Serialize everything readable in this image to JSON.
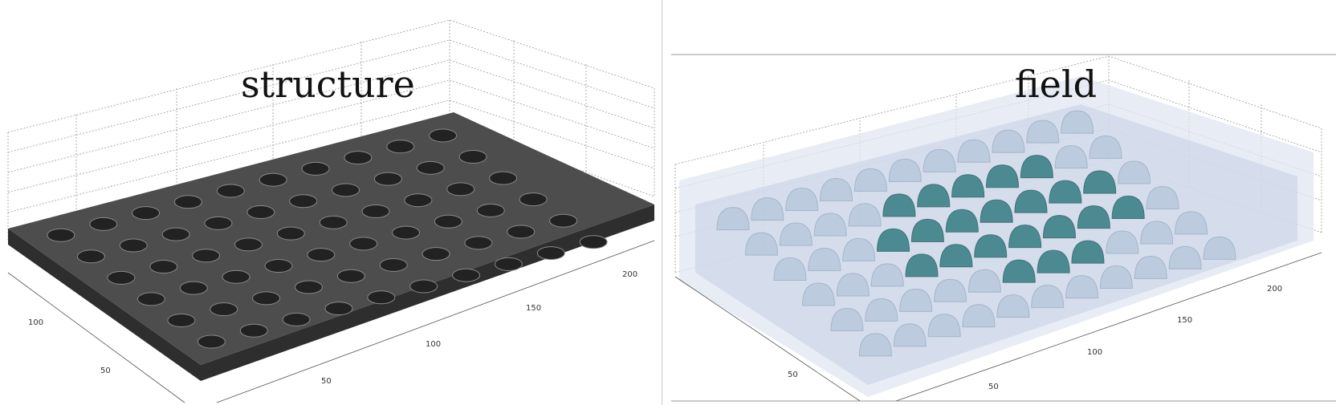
{
  "panels": [
    {
      "title": "structure",
      "ticks_x": [
        "50",
        "100",
        "150",
        "200"
      ],
      "ticks_y": [
        "50",
        "100"
      ]
    },
    {
      "title": "field",
      "ticks_x": [
        "50",
        "100",
        "150",
        "200"
      ],
      "ticks_y": [
        "50"
      ]
    }
  ],
  "colors": {
    "plate": "#4a4a4a",
    "plate_edge": "#2e2e2e",
    "field_dark": "#1f6f75",
    "field_light": "#c9d6e8"
  }
}
